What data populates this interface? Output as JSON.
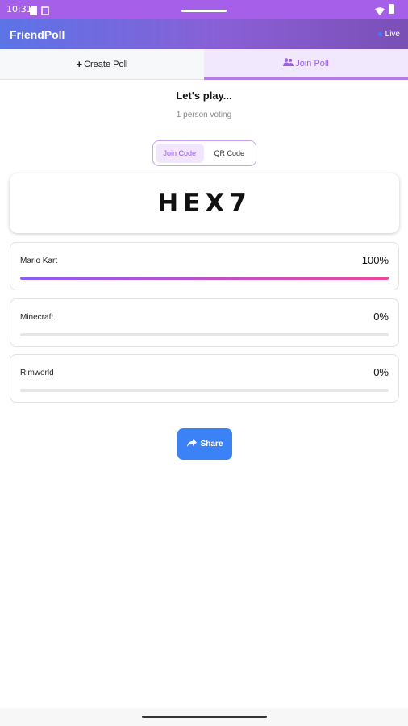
{
  "status_bar": {
    "time": "10:31"
  },
  "app": {
    "title": "FriendPoll",
    "live_label": "Live"
  },
  "tabs": [
    {
      "label": "Create Poll",
      "icon": "plus-icon",
      "active": false
    },
    {
      "label": "Join Poll",
      "icon": "users-icon",
      "active": true
    }
  ],
  "poll": {
    "heading": "Let's play...",
    "voters_text": "1 person voting",
    "code_toggle": {
      "options": [
        "Join Code",
        "QR Code"
      ],
      "selected": "Join Code"
    },
    "join_code": "HEX7",
    "options": [
      {
        "name": "Mario Kart",
        "percent_label": "100%",
        "fraction": 1.0
      },
      {
        "name": "Minecraft",
        "percent_label": "0%",
        "fraction": 0.0
      },
      {
        "name": "Rimworld",
        "percent_label": "0%",
        "fraction": 0.0
      }
    ]
  },
  "share_button": {
    "label": "Share",
    "icon": "share-icon"
  },
  "colors": {
    "accent": "#9b5fe6",
    "share_blue": "#3b82f6",
    "bar_gradient_start": "#8b5cf6",
    "bar_gradient_end": "#ec4899",
    "live_dot": "#3f7cff"
  }
}
